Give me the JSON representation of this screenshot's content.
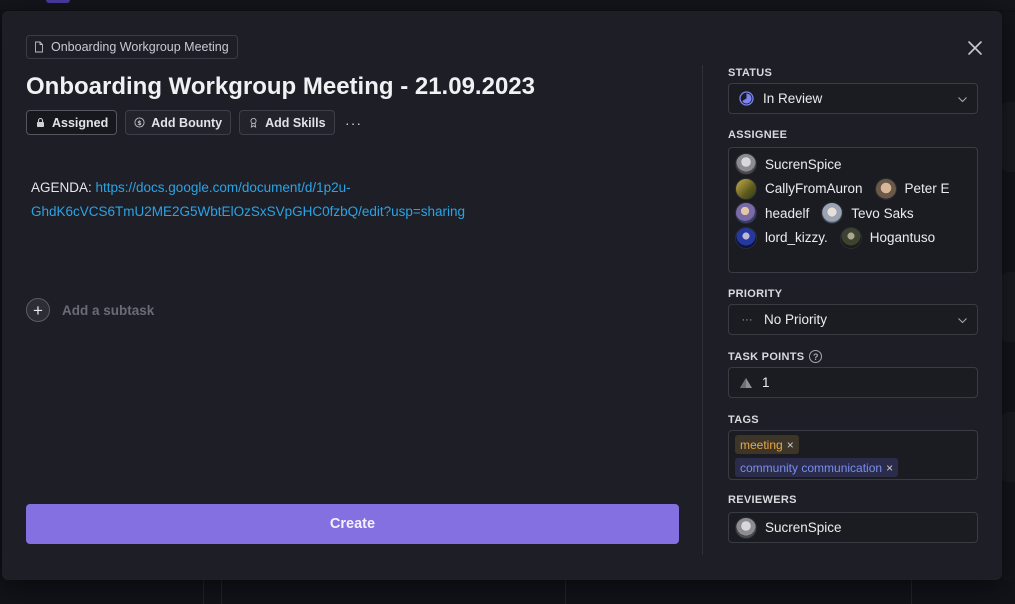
{
  "breadcrumb": {
    "label": "Onboarding Workgroup Meeting"
  },
  "task": {
    "title": "Onboarding Workgroup Meeting - 21.09.2023",
    "description_prefix": "AGENDA: ",
    "description_link": "https://docs.google.com/document/d/1p2u-GhdK6cVCS6TmU2ME2G5WbtElOzSxSVpGHC0fzbQ/edit?usp=sharing"
  },
  "actions": {
    "assigned": "Assigned",
    "add_bounty": "Add Bounty",
    "add_skills": "Add Skills",
    "more": "···"
  },
  "subtask": {
    "label": "Add a subtask",
    "plus": "+"
  },
  "create_button": "Create",
  "sidebar": {
    "status": {
      "label": "STATUS",
      "value": "In Review",
      "color": "#7b83f0"
    },
    "assignee": {
      "label": "ASSIGNEE",
      "rows": [
        [
          {
            "name": "SucrenSpice",
            "color": "#9a9aa0"
          }
        ],
        [
          {
            "name": "CallyFromAuron",
            "color": "#8a7a2e"
          },
          {
            "name": "Peter E",
            "color": "#b89a7a"
          }
        ],
        [
          {
            "name": "headelf",
            "color": "#6a7ab0"
          },
          {
            "name": "Tevo Saks",
            "color": "#a8b0c0"
          }
        ],
        [
          {
            "name": "lord_kizzy.",
            "color": "#2a3a8a"
          },
          {
            "name": "Hogantuso",
            "color": "#3a3f2a"
          }
        ]
      ]
    },
    "priority": {
      "label": "PRIORITY",
      "value": "No Priority",
      "icon": "···"
    },
    "task_points": {
      "label": "TASK POINTS",
      "value": "1",
      "help": "?"
    },
    "tags": {
      "label": "TAGS",
      "items": [
        {
          "label": "meeting",
          "style": "meeting"
        },
        {
          "label": "community communication",
          "style": "community"
        }
      ],
      "remove_glyph": "×"
    },
    "reviewers": {
      "label": "REVIEWERS",
      "items": [
        {
          "name": "SucrenSpice",
          "color": "#9a9aa0"
        }
      ]
    }
  }
}
